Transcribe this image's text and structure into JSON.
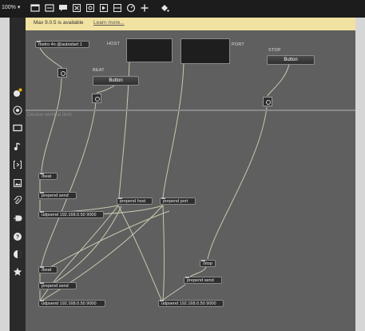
{
  "toolbar": {
    "zoom": "100% ▾",
    "icons": [
      "presentation-mode-icon",
      "patcher-icon",
      "comment-icon",
      "close-box-icon",
      "object-icon",
      "message-icon",
      "panel-icon",
      "dial-icon",
      "add-icon",
      "paint-bucket-icon"
    ]
  },
  "sidebar": {
    "icons": [
      "inspector-icon",
      "target-icon",
      "screen-icon",
      "music-note-icon",
      "bracket-icon",
      "image-icon",
      "paperclip-icon",
      "plug-icon",
      "help-icon",
      "contrast-icon",
      "star-icon"
    ]
  },
  "notification": {
    "message": "Max 9.0.5 is available",
    "link": "Learn more..."
  },
  "patch": {
    "device_label": "Device vertical limit",
    "labels": {
      "host": "HOST",
      "port": "PORT",
      "beat": "BEAT",
      "stop": "STOP"
    },
    "objects": {
      "metro": "metro 4n @autostart 1",
      "beat_a": "/beat",
      "prepend_send_a": "prepend send",
      "udpsend_a": "udpsend 192.168.0.50 9000",
      "prepend_host": "prepend host",
      "prepend_port": "prepend port",
      "beat_b": "/beat",
      "prepend_send_b": "prepend send",
      "udpsend_b": "udpsend 192.168.0.50 9000",
      "stop": "/stop",
      "prepend_send_c": "prepend send",
      "udpsend_c": "udpsend 192.168.0.50 9000"
    },
    "buttons": {
      "beat": "Button",
      "stop": "Button"
    }
  }
}
